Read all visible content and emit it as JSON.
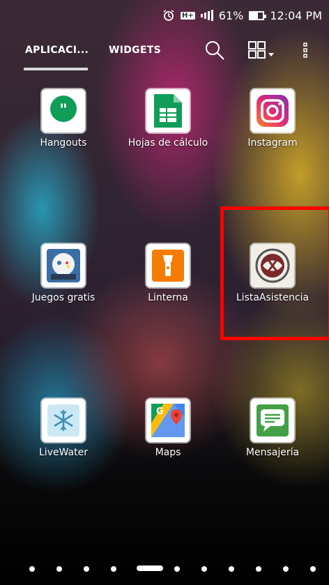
{
  "status_bar": {
    "battery_percent_label": "61%",
    "battery_level": 0.61,
    "time": "12:04 PM",
    "network_label": "H+",
    "alarm_icon": "alarm-icon",
    "signal_icon": "signal-icon"
  },
  "tabs": {
    "apps_label": "APLICACI...",
    "widgets_label": "WIDGETS",
    "search_icon": "search-icon",
    "grid_icon": "grid-view-icon",
    "more_icon": "more-options-icon"
  },
  "apps": [
    {
      "label": "Hangouts",
      "icon": "hangouts-icon",
      "color": "#0f9d58"
    },
    {
      "label": "Hojas de cálculo",
      "icon": "sheets-icon",
      "color": "#0f9d58"
    },
    {
      "label": "Instagram",
      "icon": "instagram-icon",
      "color": "#c13584"
    },
    {
      "label": "Juegos gratis",
      "icon": "games-icon",
      "color": "#3a6ea5"
    },
    {
      "label": "Linterna",
      "icon": "flashlight-icon",
      "color": "#f57c00"
    },
    {
      "label": "ListaAsistencia",
      "icon": "lista-asistencia-icon",
      "color": "#8a2a2a"
    },
    {
      "label": "LiveWater",
      "icon": "livewater-icon",
      "color": "#6fb7d8"
    },
    {
      "label": "Maps",
      "icon": "maps-icon",
      "color": "#4285f4"
    },
    {
      "label": "Mensajería",
      "icon": "messaging-icon",
      "color": "#43a047"
    }
  ],
  "page_indicator": {
    "total_pages": 12,
    "current_page": 5
  },
  "colors": {
    "highlight": "#ff0000",
    "tab_indicator": "#d8d8d8"
  }
}
